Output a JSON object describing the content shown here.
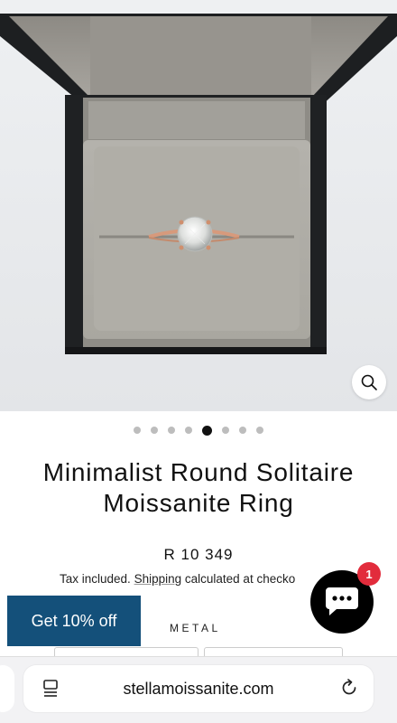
{
  "product": {
    "title_line1": "Minimalist Round Solitaire",
    "title_line2": "Moissanite Ring",
    "price": "R 10 349",
    "tax_prefix": "Tax included.",
    "shipping_link": "Shipping",
    "tax_suffix": "calculated at checko"
  },
  "gallery": {
    "image_count": 8,
    "active_index": 4,
    "zoom_icon": "search-icon"
  },
  "promo": {
    "label": "Get 10% off"
  },
  "options": {
    "metal_label": "METAL"
  },
  "chat": {
    "icon": "chat-bubble-icon",
    "unread_count": "1"
  },
  "browser": {
    "url": "stellamoissanite.com",
    "left_icon": "tabs-icon",
    "right_icon": "reload-icon"
  },
  "colors": {
    "promo_bg": "#14507a",
    "badge": "#e22c3c",
    "chat_bg": "#000000"
  }
}
